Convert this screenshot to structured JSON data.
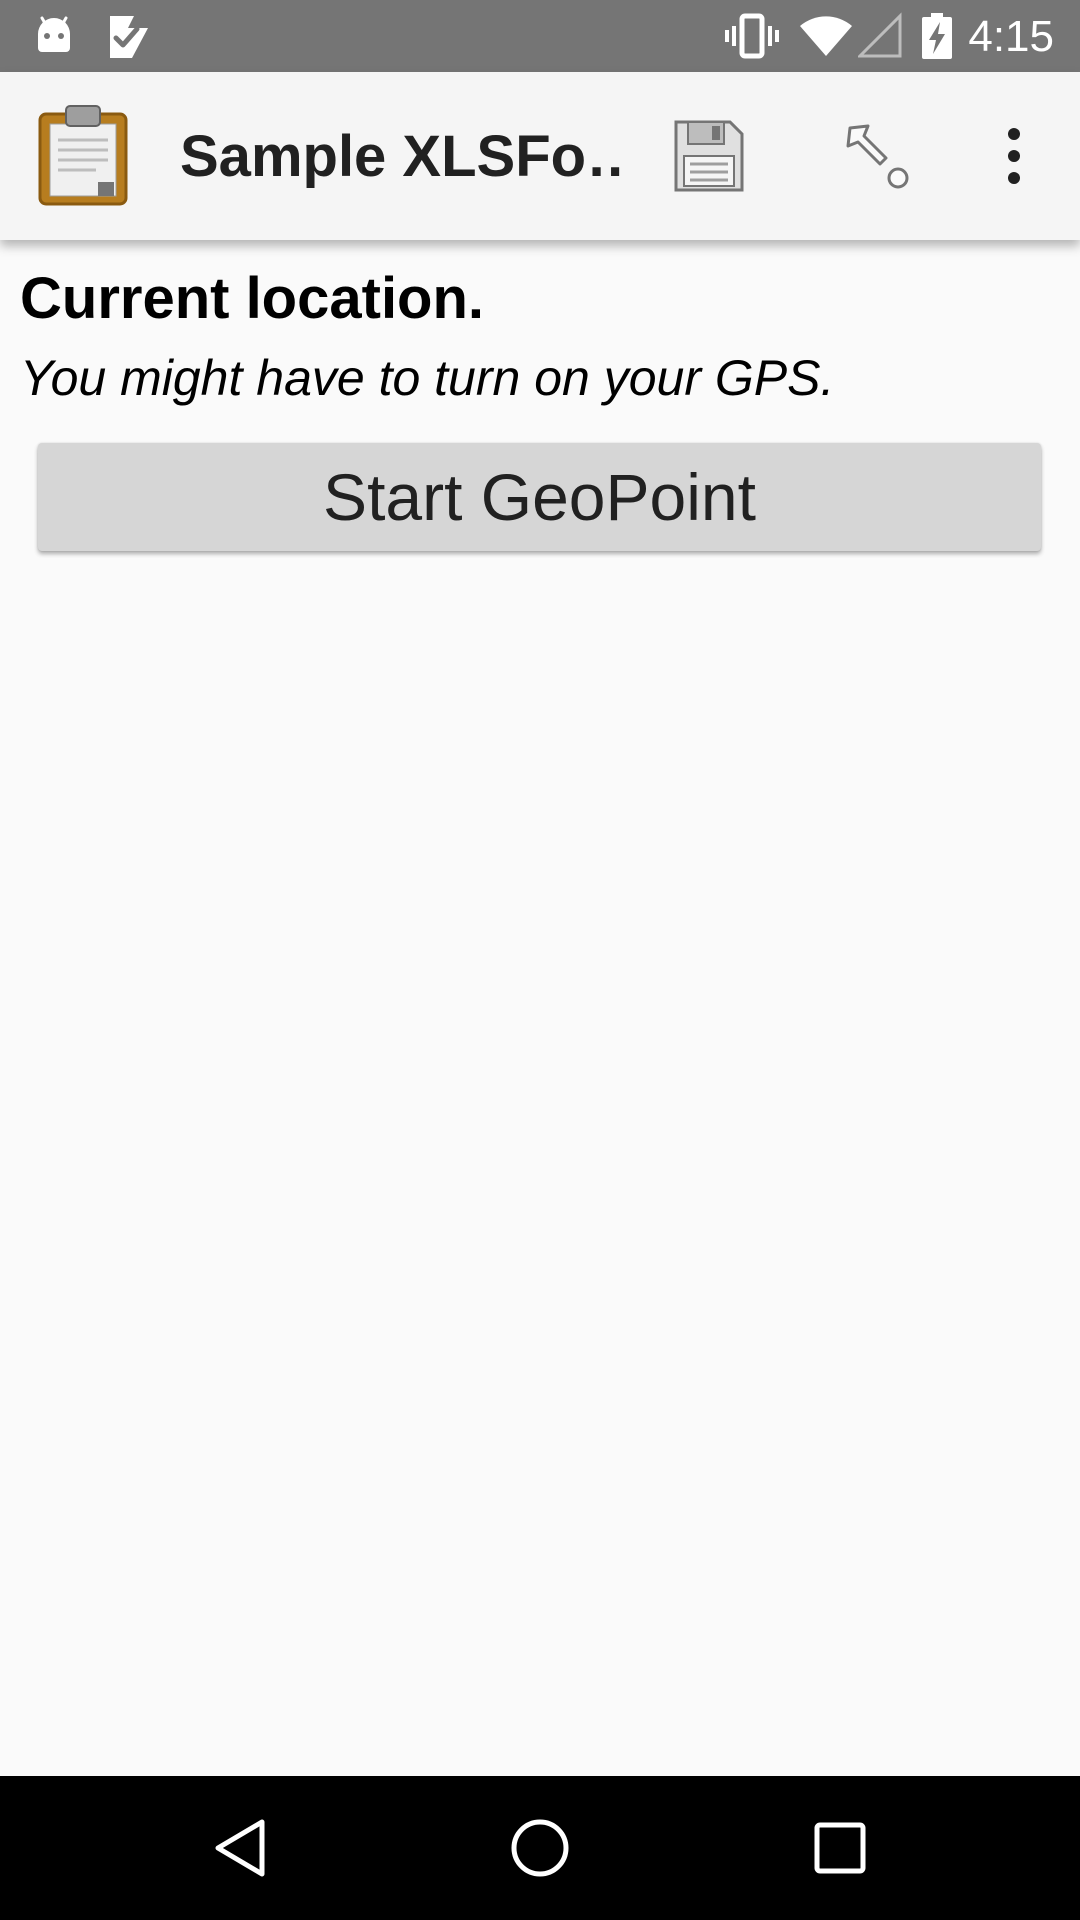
{
  "status_bar": {
    "time": "4:15",
    "icons": [
      "android-notification-icon",
      "task-check-icon",
      "vibrate-icon",
      "wifi-icon",
      "cell-signal-icon",
      "battery-charging-icon"
    ]
  },
  "app_bar": {
    "title": "Sample XLSFo…",
    "actions": [
      "save-icon",
      "go-to-prompt-icon",
      "overflow-menu-icon"
    ]
  },
  "question": {
    "label": "Current location.",
    "hint": "You might have to turn on your GPS.",
    "button_label": "Start GeoPoint"
  },
  "nav_bar": {
    "buttons": [
      "back-icon",
      "home-icon",
      "recents-icon"
    ]
  },
  "colors": {
    "status_bar": "#757575",
    "app_bar": "#f5f5f5",
    "background": "#fafafa",
    "button": "#d6d6d6",
    "nav_bar": "#000000"
  }
}
